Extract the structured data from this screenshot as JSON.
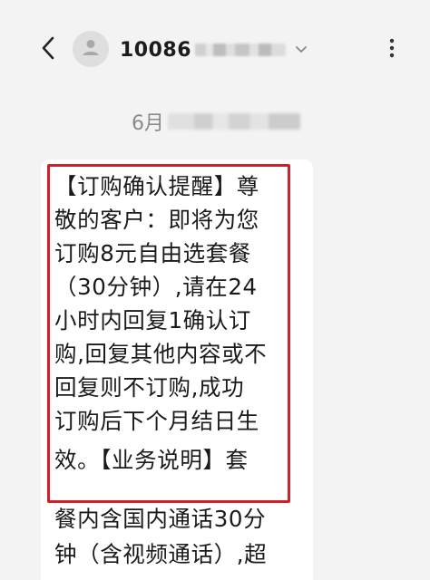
{
  "header": {
    "back_icon": "chevron-left-icon",
    "avatar_icon": "person-icon",
    "contact_number": "10086",
    "dropdown_icon": "chevron-down-icon",
    "more_icon": "vertical-ellipsis-icon"
  },
  "thread": {
    "date": "6月"
  },
  "message": {
    "lines": [
      "【订购确认提醒】尊",
      "敬的客户：即将为您",
      "订购8元自由选套餐",
      "（30分钟）,请在24",
      "小时内回复1确认订",
      "购,回复其他内容或不",
      "回复则不订购,成功",
      "订购后下个月结日生",
      "效。【业务说明】套",
      "餐内含国内通话30分",
      "钟（含视频通话）,超"
    ]
  },
  "colors": {
    "background": "#f3f3f3",
    "bubble": "#ffffff",
    "highlight_border": "#d11f2a",
    "text": "#1a1a1a",
    "muted": "#8a8a8a"
  }
}
